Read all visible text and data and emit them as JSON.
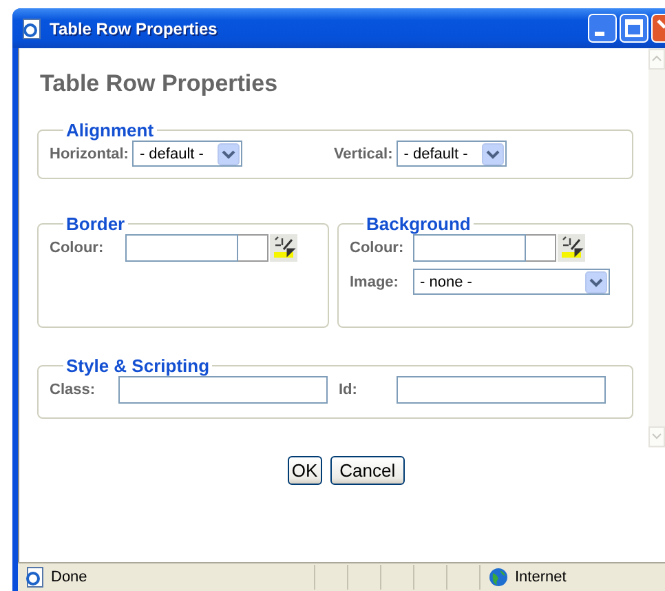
{
  "window": {
    "title": "Table Row Properties"
  },
  "heading": "Table Row Properties",
  "alignment": {
    "legend": "Alignment",
    "fields": [
      {
        "label": "Horizontal:",
        "value": "- default -"
      },
      {
        "label": "Vertical:",
        "value": "- default -"
      }
    ]
  },
  "border": {
    "legend": "Border",
    "colour_label": "Colour:"
  },
  "background": {
    "legend": "Background",
    "colour_label": "Colour:",
    "image_label": "Image:",
    "image_value": "- none -"
  },
  "style_scripting": {
    "legend": "Style & Scripting",
    "class_label": "Class:",
    "id_label": "Id:"
  },
  "buttons": [
    "OK",
    "Cancel"
  ],
  "status_bar": {
    "text": "Done",
    "zone": "Internet"
  }
}
